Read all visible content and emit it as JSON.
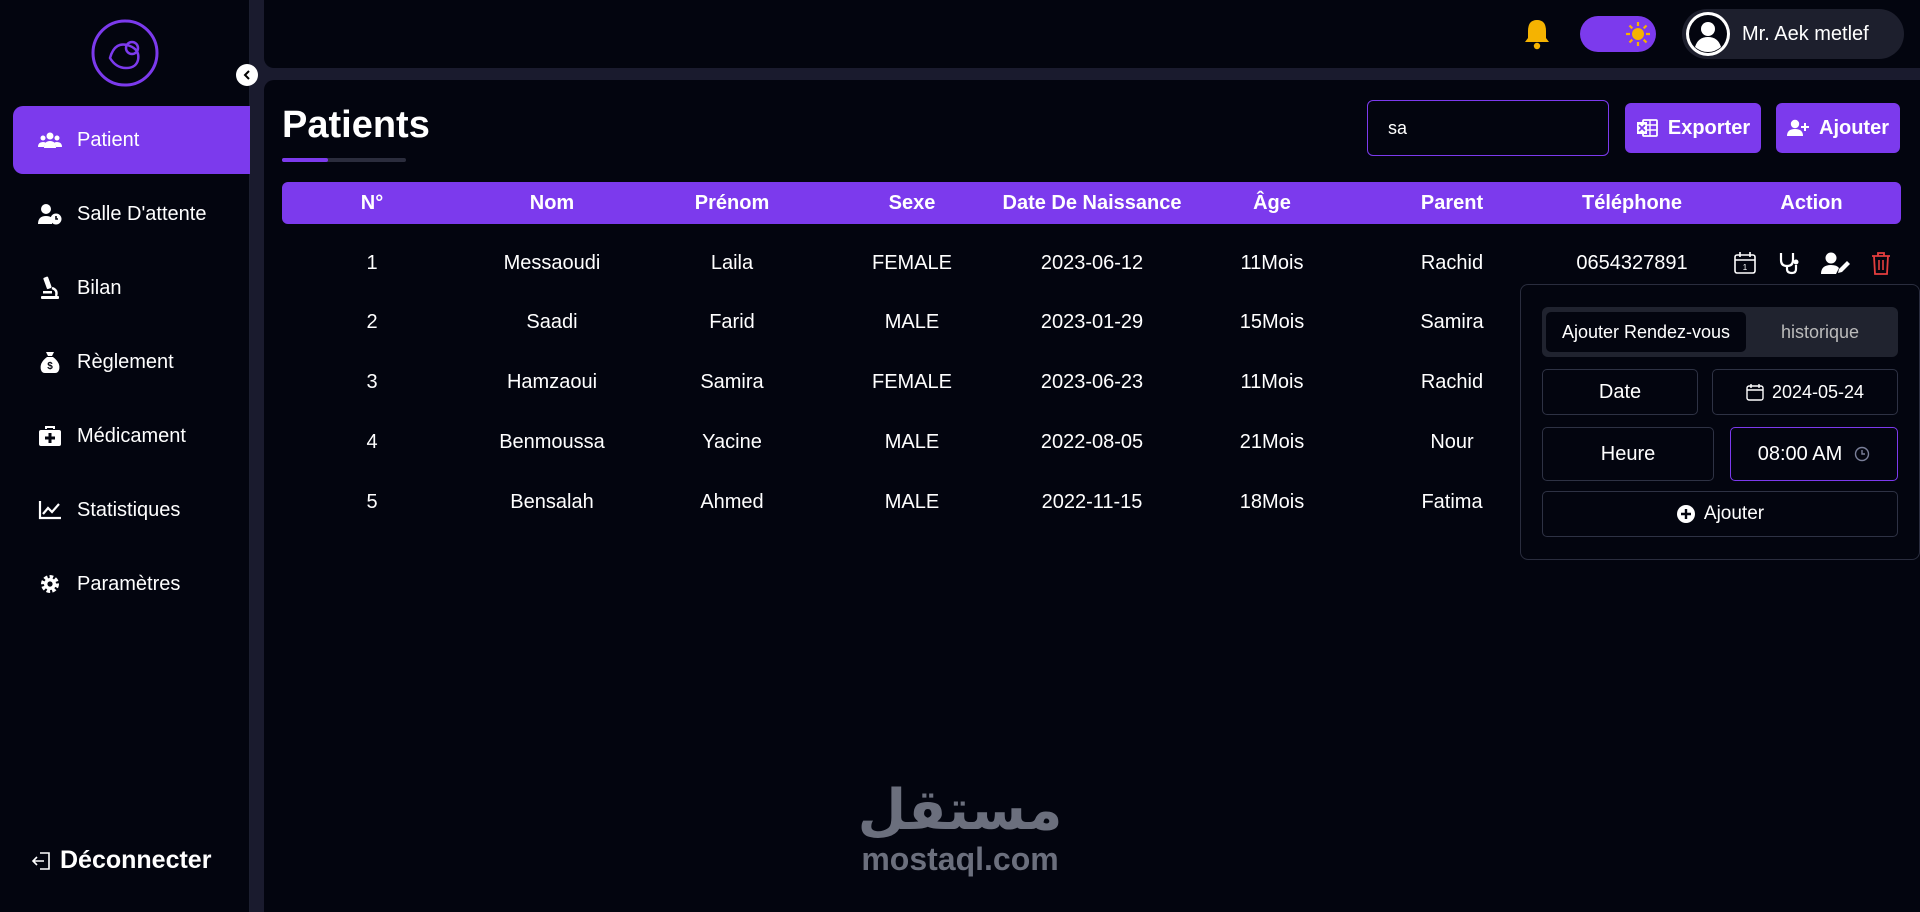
{
  "sidebar": {
    "items": [
      {
        "label": "Patient",
        "icon": "users-icon"
      },
      {
        "label": "Salle D'attente",
        "icon": "user-clock-icon"
      },
      {
        "label": "Bilan",
        "icon": "microscope-icon"
      },
      {
        "label": "Règlement",
        "icon": "money-bag-icon"
      },
      {
        "label": "Médicament",
        "icon": "medkit-icon"
      },
      {
        "label": "Statistiques",
        "icon": "chart-line-icon"
      },
      {
        "label": "Paramètres",
        "icon": "gear-icon"
      }
    ],
    "active": "Patient",
    "logout_label": "Déconnecter"
  },
  "header": {
    "user_name": "Mr. Aek metlef"
  },
  "page": {
    "title": "Patients",
    "search_value": "sa",
    "export_label": "Exporter",
    "add_label": "Ajouter"
  },
  "table": {
    "columns": [
      "N°",
      "Nom",
      "Prénom",
      "Sexe",
      "Date De Naissance",
      "Âge",
      "Parent",
      "Téléphone",
      "Action"
    ],
    "rows": [
      [
        "1",
        "Messaoudi",
        "Laila",
        "FEMALE",
        "2023-06-12",
        "11Mois",
        "Rachid",
        "0654327891"
      ],
      [
        "2",
        "Saadi",
        "Farid",
        "MALE",
        "2023-01-29",
        "15Mois",
        "Samira",
        ""
      ],
      [
        "3",
        "Hamzaoui",
        "Samira",
        "FEMALE",
        "2023-06-23",
        "11Mois",
        "Rachid",
        ""
      ],
      [
        "4",
        "Benmoussa",
        "Yacine",
        "MALE",
        "2022-08-05",
        "21Mois",
        "Nour",
        ""
      ],
      [
        "5",
        "Bensalah",
        "Ahmed",
        "MALE",
        "2022-11-15",
        "18Mois",
        "Fatima",
        ""
      ]
    ]
  },
  "popup": {
    "tab_active": "Ajouter Rendez-vous",
    "tab_inactive": "historique",
    "date_label": "Date",
    "date_value": "2024-05-24",
    "time_label": "Heure",
    "time_value": "08:00 AM",
    "add_label": "Ajouter"
  },
  "watermark": {
    "arabic": "مستقل",
    "latin": "mostaql.com"
  },
  "colors": {
    "accent": "#7c3aed",
    "background": "#03050f",
    "bell": "#f5b301",
    "delete": "#e53e3e"
  }
}
